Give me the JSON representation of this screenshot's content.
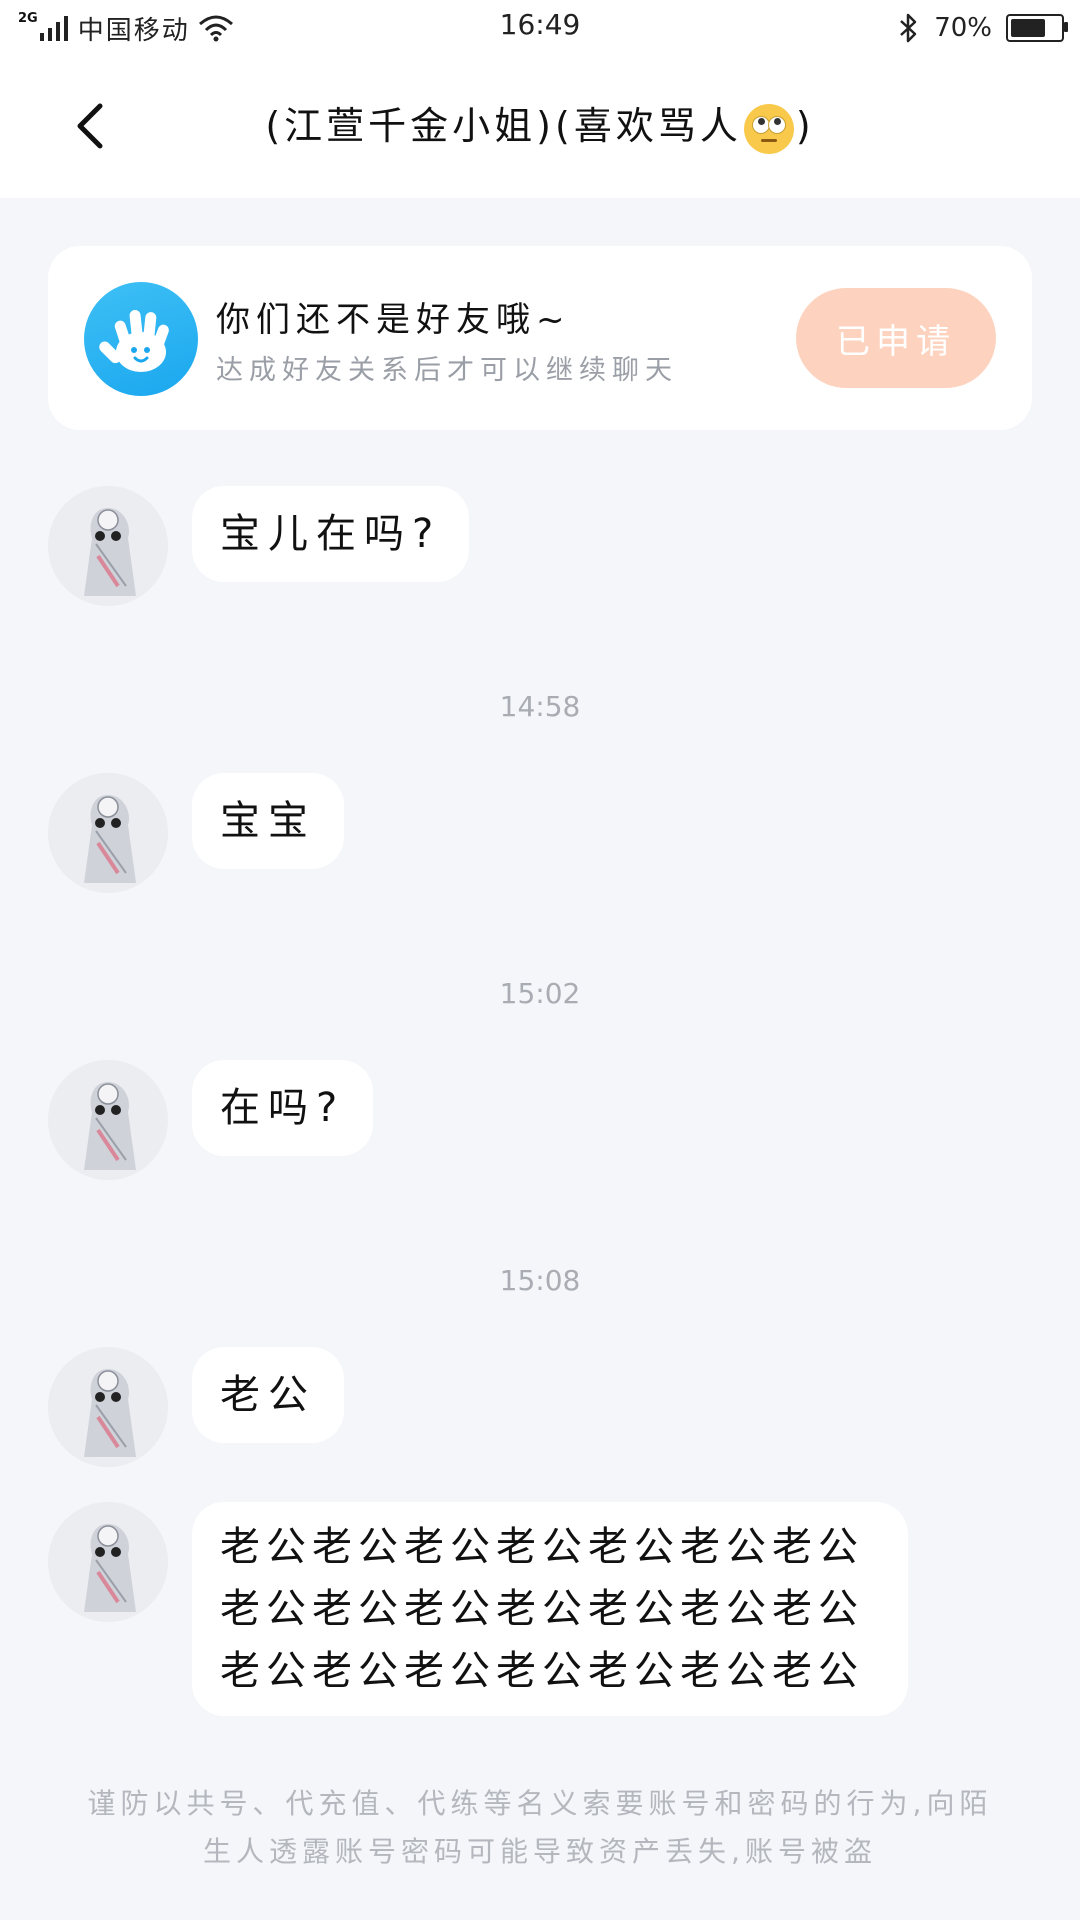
{
  "status_bar": {
    "network_tag": "2G",
    "carrier": "中国移动",
    "time": "16:49",
    "battery_text": "70%",
    "battery_level": 0.7,
    "icons": [
      "signal-icon",
      "wifi-icon",
      "bluetooth-icon",
      "battery-icon"
    ]
  },
  "nav": {
    "back_icon": "chevron-left-icon",
    "title_before": "(江萱千金小姐)(喜欢骂人",
    "title_emoji": "eye-roll-emoji",
    "title_after": ")"
  },
  "friend_notice": {
    "icon": "hand-wave-icon",
    "title": "你们还不是好友哦~",
    "subtitle": "达成好友关系后才可以继续聊天",
    "button_label": "已申请",
    "button_color": "#fdd3bf",
    "icon_color": "#1aa7ef"
  },
  "messages": [
    {
      "text": "宝儿在吗?"
    },
    {
      "time": "14:58"
    },
    {
      "text": "宝宝"
    },
    {
      "time": "15:02"
    },
    {
      "text": "在吗?"
    },
    {
      "time": "15:08"
    },
    {
      "text": "老公"
    },
    {
      "text": "老公老公老公老公老公老公老公老公老公老公老公老公老公老公老公老公老公老公老公老公老公"
    }
  ],
  "footer_warning": "谨防以共号、代充值、代练等名义索要账号和密码的行为,向陌生人透露账号密码可能导致资产丢失,账号被盗"
}
